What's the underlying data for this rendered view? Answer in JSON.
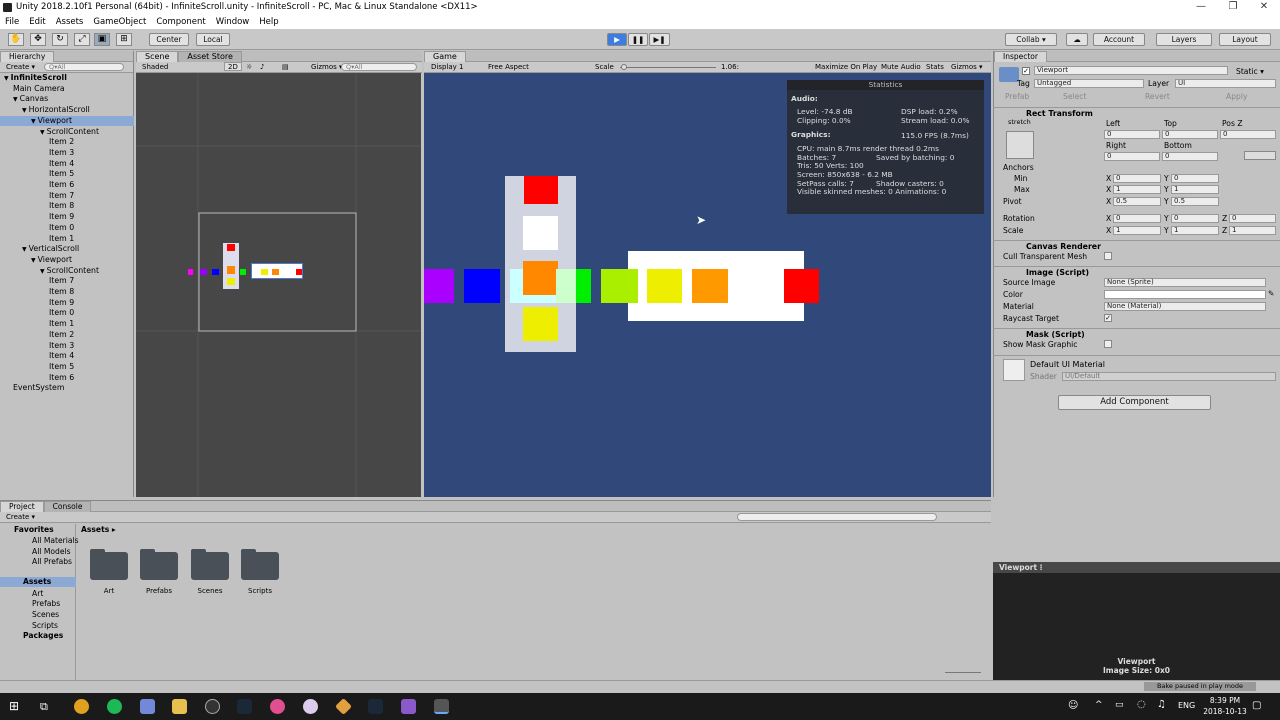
{
  "window": {
    "title": "Unity 2018.2.10f1 Personal (64bit) - InfiniteScroll.unity - InfiniteScroll - PC, Mac & Linux Standalone <DX11>",
    "controls": [
      "—",
      "❐",
      "✕"
    ]
  },
  "menu": [
    "File",
    "Edit",
    "Assets",
    "GameObject",
    "Component",
    "Window",
    "Help"
  ],
  "toolbar": {
    "center": "Center",
    "local": "Local",
    "collab": "Collab ▾",
    "account": "Account",
    "layers": "Layers",
    "layout": "Layout",
    "play": "▶",
    "pause": "❚❚",
    "step": "▶❚"
  },
  "hierarchy": {
    "tab": "Hierarchy",
    "create": "Create ▾",
    "search": "Q▾All",
    "rows": [
      {
        "label": "InfiniteScroll",
        "indent": 0,
        "arrow": "▼",
        "bold": true
      },
      {
        "label": "Main Camera",
        "indent": 1
      },
      {
        "label": "Canvas",
        "indent": 1,
        "arrow": "▼"
      },
      {
        "label": "HorizontalScroll",
        "indent": 2,
        "arrow": "▼"
      },
      {
        "label": "Viewport",
        "indent": 3,
        "arrow": "▼",
        "sel": true
      },
      {
        "label": "ScrollContent",
        "indent": 4,
        "arrow": "▼"
      },
      {
        "label": "Item 2",
        "indent": 5
      },
      {
        "label": "Item 3",
        "indent": 5
      },
      {
        "label": "Item 4",
        "indent": 5
      },
      {
        "label": "Item 5",
        "indent": 5
      },
      {
        "label": "Item 6",
        "indent": 5
      },
      {
        "label": "Item 7",
        "indent": 5
      },
      {
        "label": "Item 8",
        "indent": 5
      },
      {
        "label": "Item 9",
        "indent": 5
      },
      {
        "label": "Item 0",
        "indent": 5
      },
      {
        "label": "Item 1",
        "indent": 5
      },
      {
        "label": "VerticalScroll",
        "indent": 2,
        "arrow": "▼"
      },
      {
        "label": "Viewport",
        "indent": 3,
        "arrow": "▼"
      },
      {
        "label": "ScrollContent",
        "indent": 4,
        "arrow": "▼"
      },
      {
        "label": "Item 7",
        "indent": 5
      },
      {
        "label": "Item 8",
        "indent": 5
      },
      {
        "label": "Item 9",
        "indent": 5
      },
      {
        "label": "Item 0",
        "indent": 5
      },
      {
        "label": "Item 1",
        "indent": 5
      },
      {
        "label": "Item 2",
        "indent": 5
      },
      {
        "label": "Item 3",
        "indent": 5
      },
      {
        "label": "Item 4",
        "indent": 5
      },
      {
        "label": "Item 5",
        "indent": 5
      },
      {
        "label": "Item 6",
        "indent": 5
      },
      {
        "label": "EventSystem",
        "indent": 1
      }
    ]
  },
  "scene": {
    "tabs": [
      "Scene",
      "Asset Store"
    ],
    "shaded": "Shaded",
    "mode2d": "2D",
    "gizmos": "Gizmos ▾",
    "search": "Q▾All"
  },
  "game": {
    "tab": "Game",
    "display": "Display 1",
    "aspect": "Free Aspect",
    "scale_label": "Scale",
    "scale_value": "1.06:",
    "maximize": "Maximize On Play",
    "mute": "Mute Audio",
    "stats": "Stats",
    "gizmos": "Gizmos ▾"
  },
  "statistics": {
    "title": "Statistics",
    "audio": "Audio:",
    "level": "Level: -74.8 dB",
    "dsp": "DSP load: 0.2%",
    "clipping": "Clipping: 0.0%",
    "stream": "Stream load: 0.0%",
    "graphics": "Graphics:",
    "fps": "115.0 FPS (8.7ms)",
    "cpu": "CPU: main 8.7ms  render thread 0.2ms",
    "batches": "Batches: 7",
    "saved": "Saved by batching: 0",
    "tris": "Tris: 50   Verts: 100",
    "screen": "Screen: 850x638 - 6.2 MB",
    "setpass": "SetPass calls: 7",
    "shadow": "Shadow casters: 0",
    "skinned": "Visible skinned meshes: 0  Animations: 0"
  },
  "inspector": {
    "tab": "Inspector",
    "name": "Viewport",
    "static": "Static ▾",
    "tag_label": "Tag",
    "tag": "Untagged",
    "layer_label": "Layer",
    "layer": "UI",
    "prefab": "Prefab",
    "select": "Select",
    "revert": "Revert",
    "apply": "Apply",
    "rect": {
      "title": "Rect Transform",
      "stretch": "stretch",
      "left": "Left",
      "top": "Top",
      "posz": "Pos Z",
      "left_v": "0",
      "top_v": "0",
      "posz_v": "0",
      "right": "Right",
      "bottom": "Bottom",
      "right_v": "0",
      "bottom_v": "0",
      "anchors": "Anchors",
      "min": "Min",
      "max": "Max",
      "pivot": "Pivot",
      "rotation": "Rotation",
      "scale": "Scale",
      "min_x": "0",
      "min_y": "0",
      "max_x": "1",
      "max_y": "1",
      "pivot_x": "0.5",
      "pivot_y": "0.5",
      "rot_x": "0",
      "rot_y": "0",
      "rot_z": "0",
      "scale_x": "1",
      "scale_y": "1",
      "scale_z": "1"
    },
    "canvas_renderer": "Canvas Renderer",
    "cull": "Cull Transparent Mesh",
    "image": {
      "title": "Image (Script)",
      "source_label": "Source Image",
      "source": "None (Sprite)",
      "color_label": "Color",
      "material_label": "Material",
      "material": "None (Material)",
      "raycast": "Raycast Target"
    },
    "mask": {
      "title": "Mask (Script)",
      "show": "Show Mask Graphic"
    },
    "material": {
      "name": "Default UI Material",
      "shader_label": "Shader",
      "shader": "UI/Default"
    },
    "add_component": "Add Component"
  },
  "project": {
    "tabs": [
      "Project",
      "Console"
    ],
    "create": "Create ▾",
    "favorites": "Favorites",
    "fav_items": [
      "All Materials",
      "All Models",
      "All Prefabs"
    ],
    "assets_root": "Assets",
    "asset_tree": [
      "Art",
      "Prefabs",
      "Scenes",
      "Scripts"
    ],
    "packages": "Packages",
    "breadcrumb": "Assets ▸",
    "folders": [
      "Art",
      "Prefabs",
      "Scenes",
      "Scripts"
    ]
  },
  "preview": {
    "title": "Viewport ⁝",
    "caption": "Viewport",
    "size": "Image Size: 0x0"
  },
  "status": {
    "bake": "Bake paused in play mode"
  },
  "taskbar": {
    "lang": "ENG",
    "time": "8:39 PM",
    "date": "2018-10-13"
  },
  "colors": {
    "game_bg": "#31497a",
    "scene_bg": "#474747",
    "selection": "#8ca8d4",
    "play": "#3d7de0"
  }
}
